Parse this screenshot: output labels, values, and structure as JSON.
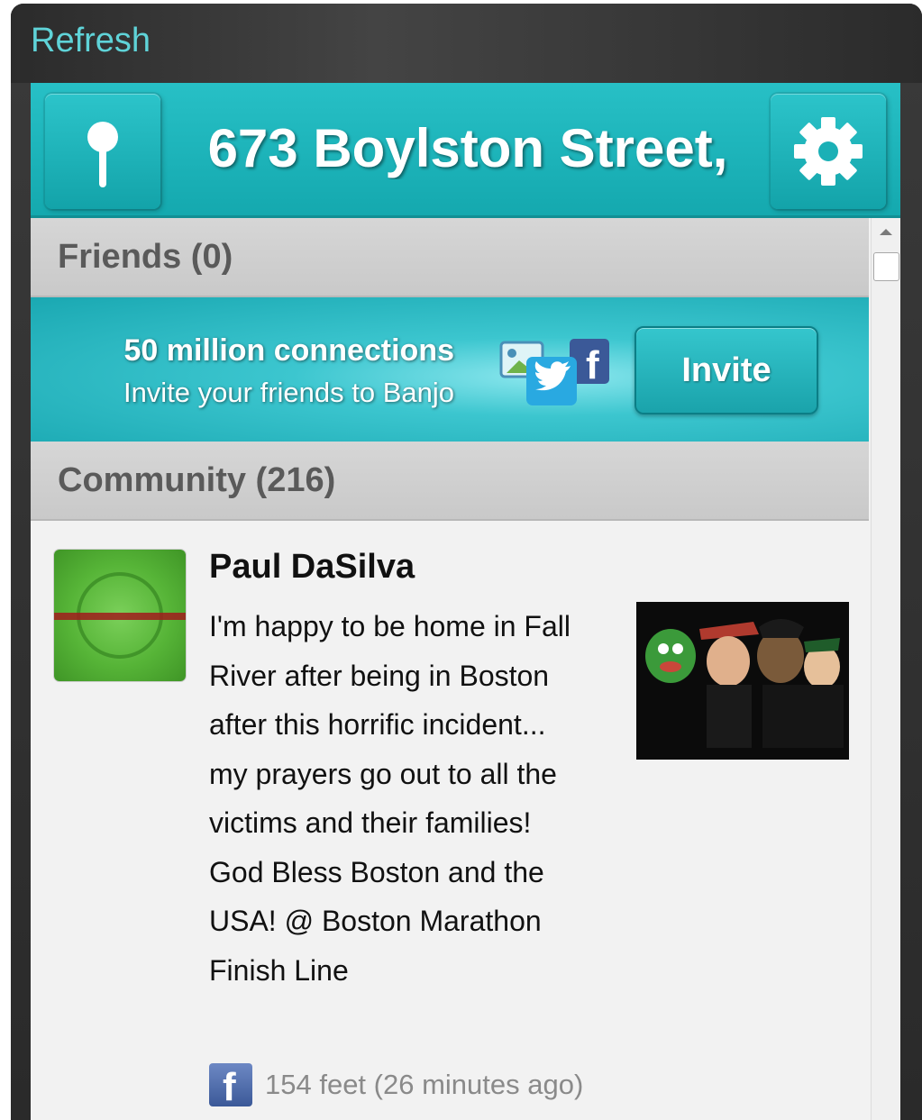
{
  "toolbar": {
    "refresh_label": "Refresh"
  },
  "header": {
    "location": "673 Boylston Street,",
    "left_icon": "pin-icon",
    "right_icon": "gear-icon"
  },
  "friends_section": {
    "title": "Friends (0)"
  },
  "invite_banner": {
    "line1": "50 million connections",
    "line2": "Invite your friends to Banjo",
    "button_label": "Invite",
    "icons": [
      "photo-icon",
      "twitter-icon",
      "facebook-icon"
    ]
  },
  "community_section": {
    "title": "Community (216)"
  },
  "posts": [
    {
      "author": "Paul DaSilva",
      "text": "I'm happy to be home in Fall River after being in Boston after this horrific incident... my prayers go out to all the victims and their families! God Bless Boston and the USA! @ Boston Marathon Finish Line",
      "source_icon": "facebook-icon",
      "meta": "154 feet (26 minutes ago)"
    }
  ],
  "colors": {
    "accent": "#1aa8b2",
    "refresh": "#5fd3d8",
    "section_header": "#cfcfcf",
    "meta_text": "#8a8a8a"
  }
}
